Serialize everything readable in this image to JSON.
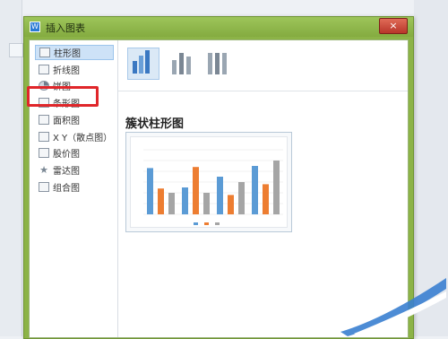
{
  "dialog": {
    "title": "插入图表",
    "close_label": "×"
  },
  "chart_types": [
    {
      "label": "柱形图",
      "icon": "column-chart-icon",
      "selected": true
    },
    {
      "label": "折线图",
      "icon": "line-chart-icon"
    },
    {
      "label": "饼图",
      "icon": "pie-chart-icon",
      "highlighted": true
    },
    {
      "label": "条形图",
      "icon": "bar-chart-icon"
    },
    {
      "label": "面积图",
      "icon": "area-chart-icon"
    },
    {
      "label": "X Y（散点图）",
      "icon": "scatter-chart-icon"
    },
    {
      "label": "股价图",
      "icon": "stock-chart-icon"
    },
    {
      "label": "雷达图",
      "icon": "radar-chart-icon"
    },
    {
      "label": "组合图",
      "icon": "combo-chart-icon"
    }
  ],
  "subtypes": [
    {
      "icon": "clustered-column-icon",
      "selected": true
    },
    {
      "icon": "stacked-column-icon"
    },
    {
      "icon": "percent-stacked-column-icon"
    }
  ],
  "selected_subtype_title": "簇状柱形图",
  "colors": {
    "titlebar": "#8cb347",
    "highlight": "#e0262a",
    "series1": "#5b9bd5",
    "series2": "#ed7d31",
    "series3": "#a5a5a5"
  },
  "chart_data": {
    "type": "bar",
    "categories": [
      "",
      "",
      "",
      ""
    ],
    "series": [
      {
        "values": [
          4.3,
          2.5,
          3.5,
          4.5
        ]
      },
      {
        "values": [
          2.4,
          4.4,
          1.8,
          2.8
        ]
      },
      {
        "values": [
          2.0,
          2.0,
          3.0,
          5.0
        ]
      }
    ],
    "ylim": [
      0,
      6
    ],
    "grid": true,
    "legend": "bottom"
  }
}
